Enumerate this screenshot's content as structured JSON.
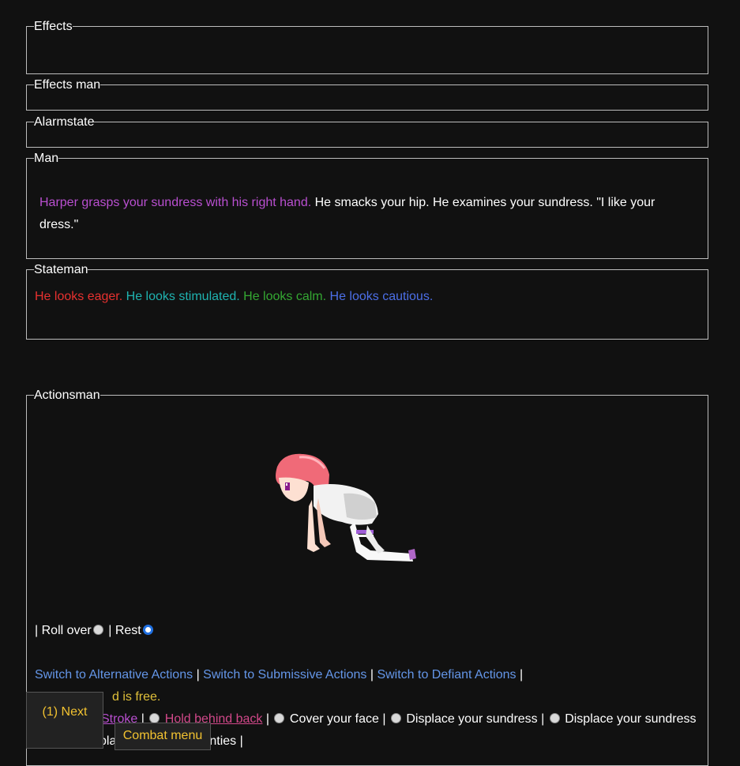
{
  "sections": {
    "effects": "Effects",
    "effects_man": "Effects man",
    "alarmstate": "Alarmstate",
    "man": "Man",
    "stateman": "Stateman",
    "actionsman": "Actionsman"
  },
  "man": {
    "action": "Harper grasps your sundress with his right hand.",
    "rest": " He smacks your hip. He examines your sundress. \"I like your dress.\""
  },
  "stateman": {
    "eager": "He looks eager.",
    "stimulated": "He looks stimulated.",
    "calm": "He looks calm.",
    "cautious": "He looks cautious."
  },
  "actions": {
    "sep": "|",
    "roll_over": "Roll over",
    "rest": "Rest",
    "switch_alt": "Switch to Alternative Actions",
    "switch_sub": "Switch to Submissive Actions",
    "switch_def": "Switch to Defiant Actions",
    "hand_free": "d is free.",
    "stroke": "Stroke",
    "hold_behind": "Hold behind back",
    "cover_face": "Cover your face",
    "displace_sundress_1": "Displace your sundress",
    "displace_sundress_2": "Displace your sundress",
    "line5_a": "pla",
    "line5_b": "nties"
  },
  "buttons": {
    "next": "(1) Next",
    "combat_menu": "Combat menu"
  },
  "colors": {
    "background": "#111111",
    "link": "#6496e8",
    "accent": "#f2c230"
  }
}
